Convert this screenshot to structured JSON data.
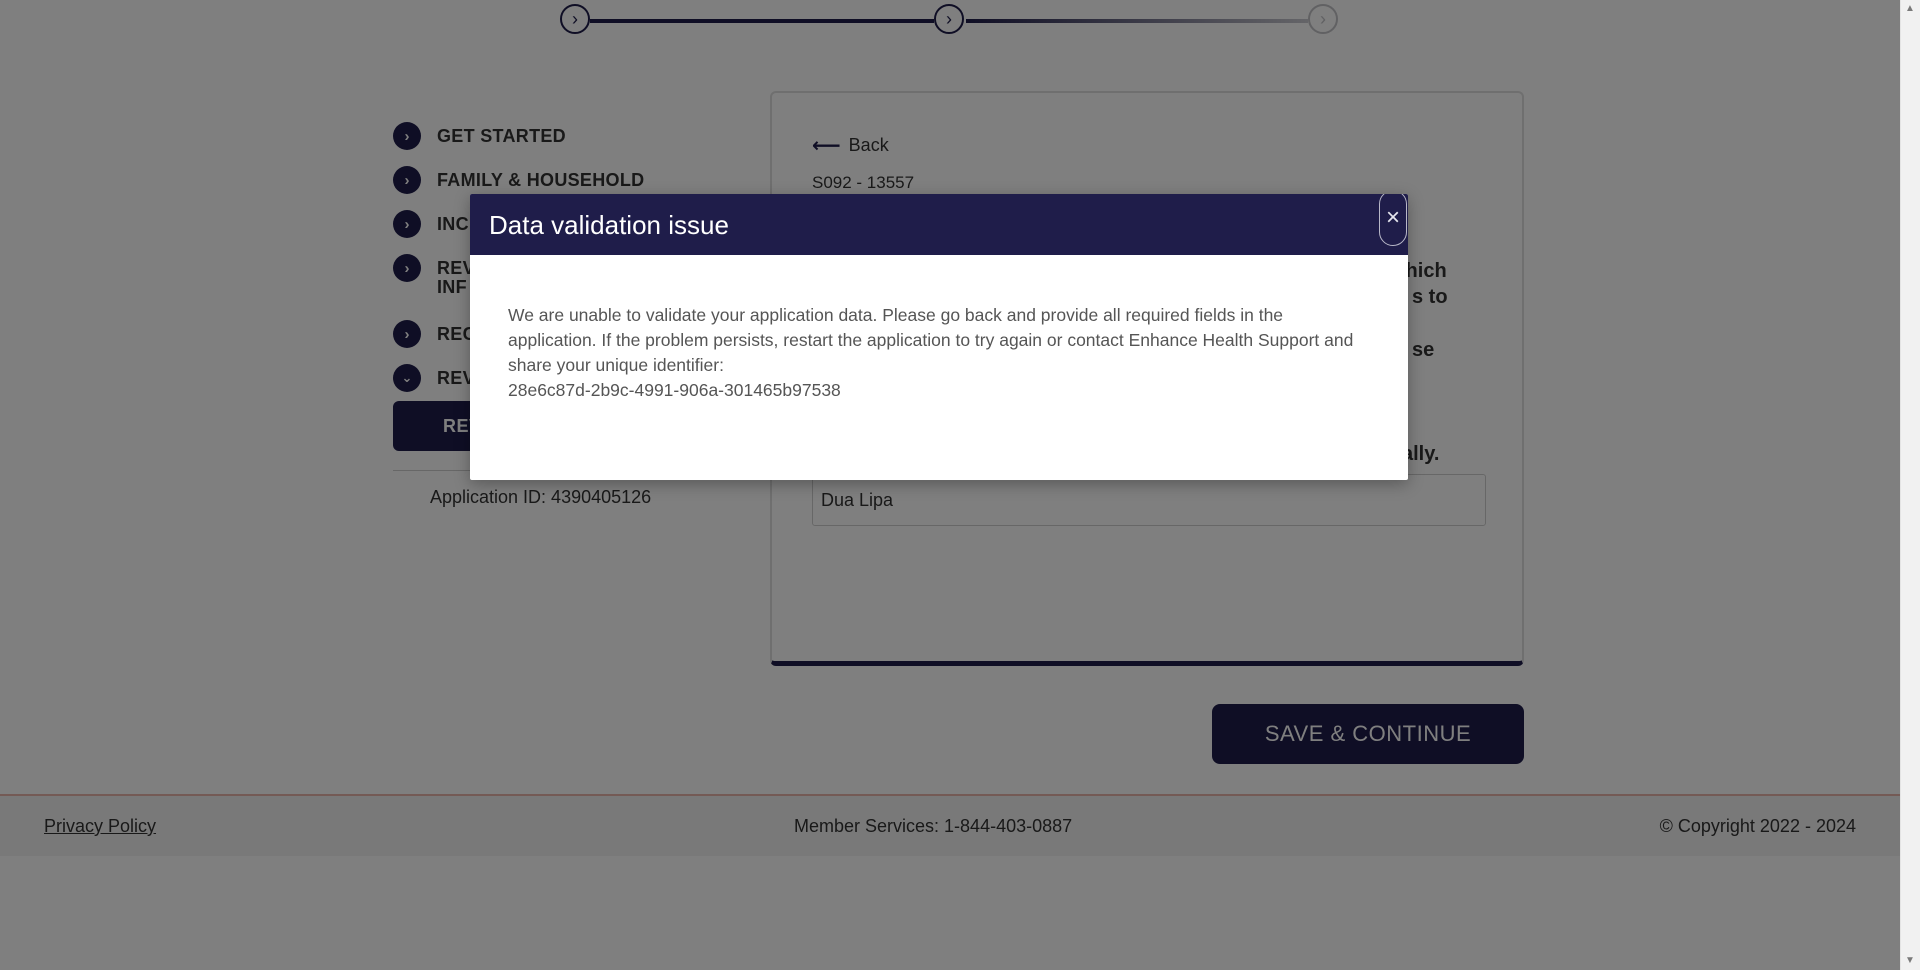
{
  "stepper": {
    "icons": [
      "chevron-right-icon",
      "chevron-right-icon",
      "chevron-right-icon"
    ]
  },
  "nav": {
    "items": [
      {
        "label": "GET STARTED",
        "icon": "chevron-right-icon"
      },
      {
        "label": "FAMILY & HOUSEHOLD",
        "icon": "chevron-right-icon"
      },
      {
        "label": "INC",
        "icon": "chevron-right-icon"
      },
      {
        "label": "REV",
        "label_line2": "INF",
        "icon": "chevron-right-icon"
      },
      {
        "label": "REC",
        "icon": "chevron-right-icon"
      },
      {
        "label": "REV",
        "icon": "chevron-down-icon"
      }
    ],
    "active_button_label": "REV",
    "application_id": "Application ID: 4390405126"
  },
  "card": {
    "back_label": "Back",
    "form_code": "S092 - 13557",
    "question_fragments": [
      "which",
      "s to",
      "se",
      "ally."
    ],
    "name_value": "Dua Lipa"
  },
  "save_button_label": "SAVE & CONTINUE",
  "footer": {
    "privacy": "Privacy Policy",
    "member_services": "Member Services: 1-844-403-0887",
    "copyright": "© Copyright 2022 - 2024"
  },
  "modal": {
    "title": "Data validation issue",
    "close_glyph": "×",
    "message": "We are unable to validate your application data. Please go back and provide all required fields in the application. If the problem persists, restart the application to try again or contact Enhance Health Support and share your unique identifier:",
    "identifier": "28e6c87d-2b9c-4991-906a-301465b97538"
  },
  "colors": {
    "brand": "#1f1d4a",
    "overlay": "rgba(0,0,0,0.5)"
  }
}
